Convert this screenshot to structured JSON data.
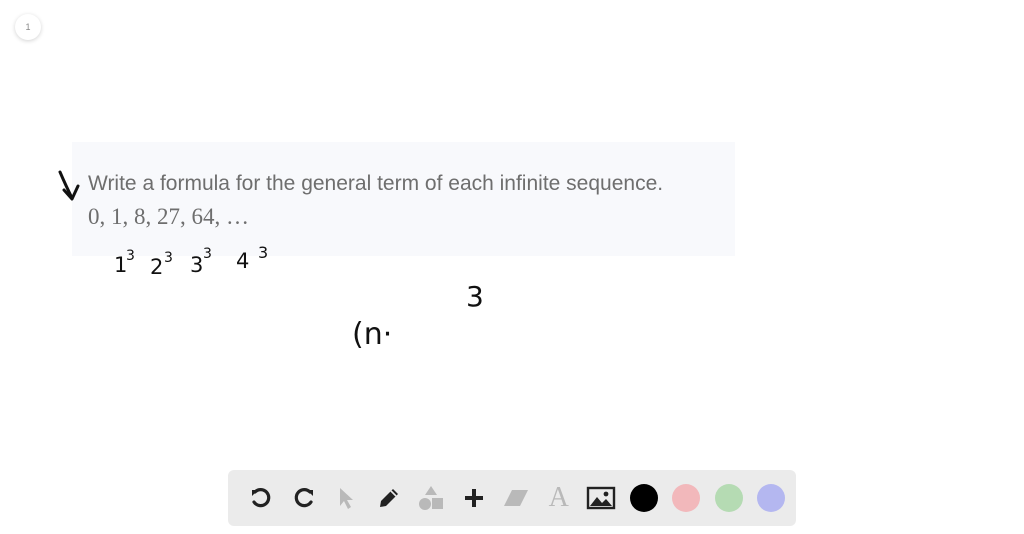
{
  "page": {
    "number": "1"
  },
  "question": {
    "prompt": "Write a formula for the general term of each infinite sequence.",
    "sequence": "0, 1, 8, 27, 64, …"
  },
  "handwriting": {
    "cube_1_base": "1",
    "cube_1_exp": "3",
    "cube_2_base": "2",
    "cube_2_exp": "3",
    "cube_3_base": "3",
    "cube_3_exp": "3",
    "cube_4_base": "4",
    "cube_4_exp": "3",
    "formula": "(n·",
    "formula_exp": "3"
  },
  "toolbar": {
    "tools": [
      "undo-icon",
      "redo-icon",
      "pointer-icon",
      "pen-icon",
      "shapes-icon",
      "add-icon",
      "eraser-icon",
      "text-icon",
      "image-icon"
    ],
    "text_tool_glyph": "A",
    "colors": {
      "black": "#000000",
      "pink": "#f2b8bb",
      "green": "#b5dbb3",
      "blue": "#b4b7f0"
    }
  }
}
